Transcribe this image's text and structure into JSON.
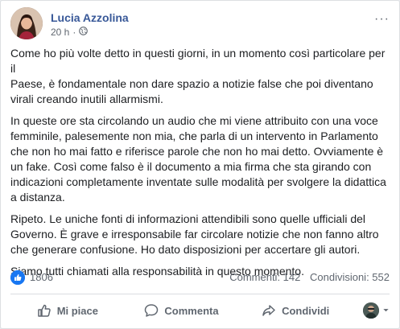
{
  "post": {
    "author": "Lucia Azzolina",
    "timestamp": "20 h",
    "privacy": "·",
    "more": "···",
    "paragraphs": [
      "Come ho più volte detto in questi giorni, in un momento così particolare per il\nPaese, è fondamentale non dare spazio a notizie false che poi diventano\nvirali creando inutili allarmismi.",
      "In queste ore sta circolando un audio che mi viene attribuito con una voce\nfemminile, palesemente non mia, che parla di un intervento in Parlamento\nche non ho mai fatto e riferisce parole che non ho mai detto. Ovviamente è\nun fake. Così come falso è il documento a mia firma che sta girando con\nindicazioni completamente inventate sulle modalità per svolgere la didattica\na distanza.",
      "Ripeto. Le uniche fonti di informazioni attendibili sono quelle ufficiali del\nGoverno. È grave e irresponsabile far circolare notizie che non fanno altro\nche generare confusione. Ho dato disposizioni per accertare gli autori.",
      "Siamo tutti chiamati alla responsabilità in questo momento."
    ]
  },
  "stats": {
    "reactions": "1806",
    "comments": "Commenti: 142",
    "shares": "Condivisioni: 552"
  },
  "actions": {
    "like": "Mi piace",
    "comment": "Commenta",
    "share": "Condividi"
  },
  "colors": {
    "author": "#385898",
    "accent": "#1877f2",
    "muted": "#606770"
  }
}
